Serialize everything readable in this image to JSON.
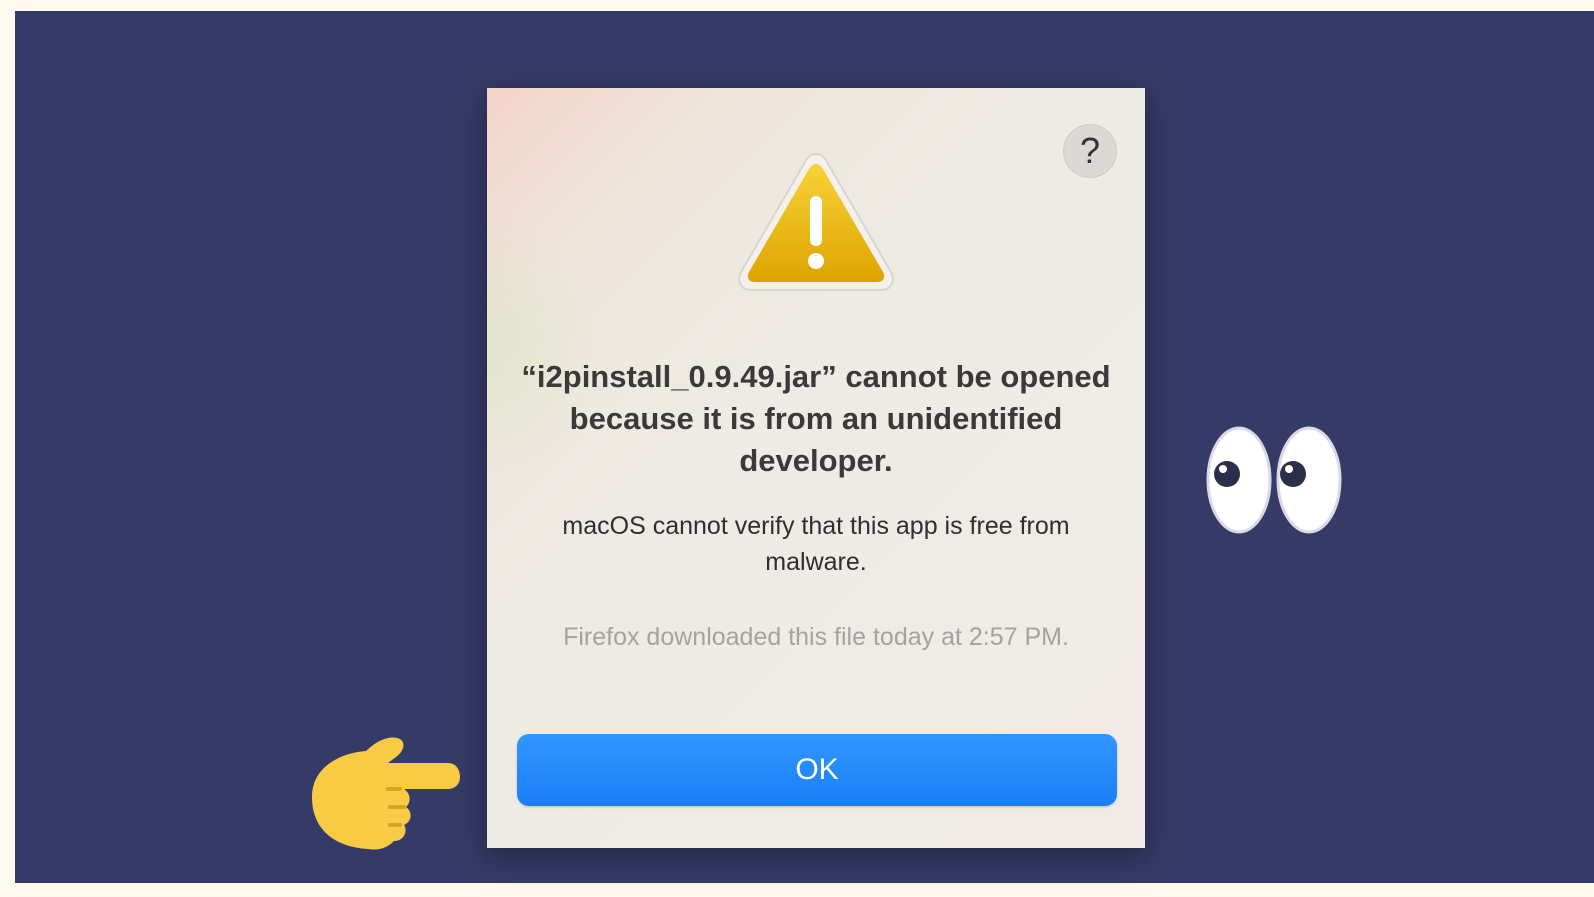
{
  "dialog": {
    "help_label": "?",
    "title": "“i2pinstall_0.9.49.jar” cannot be opened because it is from an unidentified developer.",
    "message": "macOS cannot verify that this app is free from malware.",
    "source": "Firefox downloaded this file today at 2:57 PM.",
    "ok_label": "OK"
  },
  "decor": {
    "warning_icon": "warning-triangle-icon",
    "eyes_icon": "eyes-emoji-icon",
    "hand_icon": "pointing-right-hand-icon"
  },
  "colors": {
    "background": "#363a66",
    "accent": "#1a7ff7",
    "warning": "#e6b000"
  }
}
